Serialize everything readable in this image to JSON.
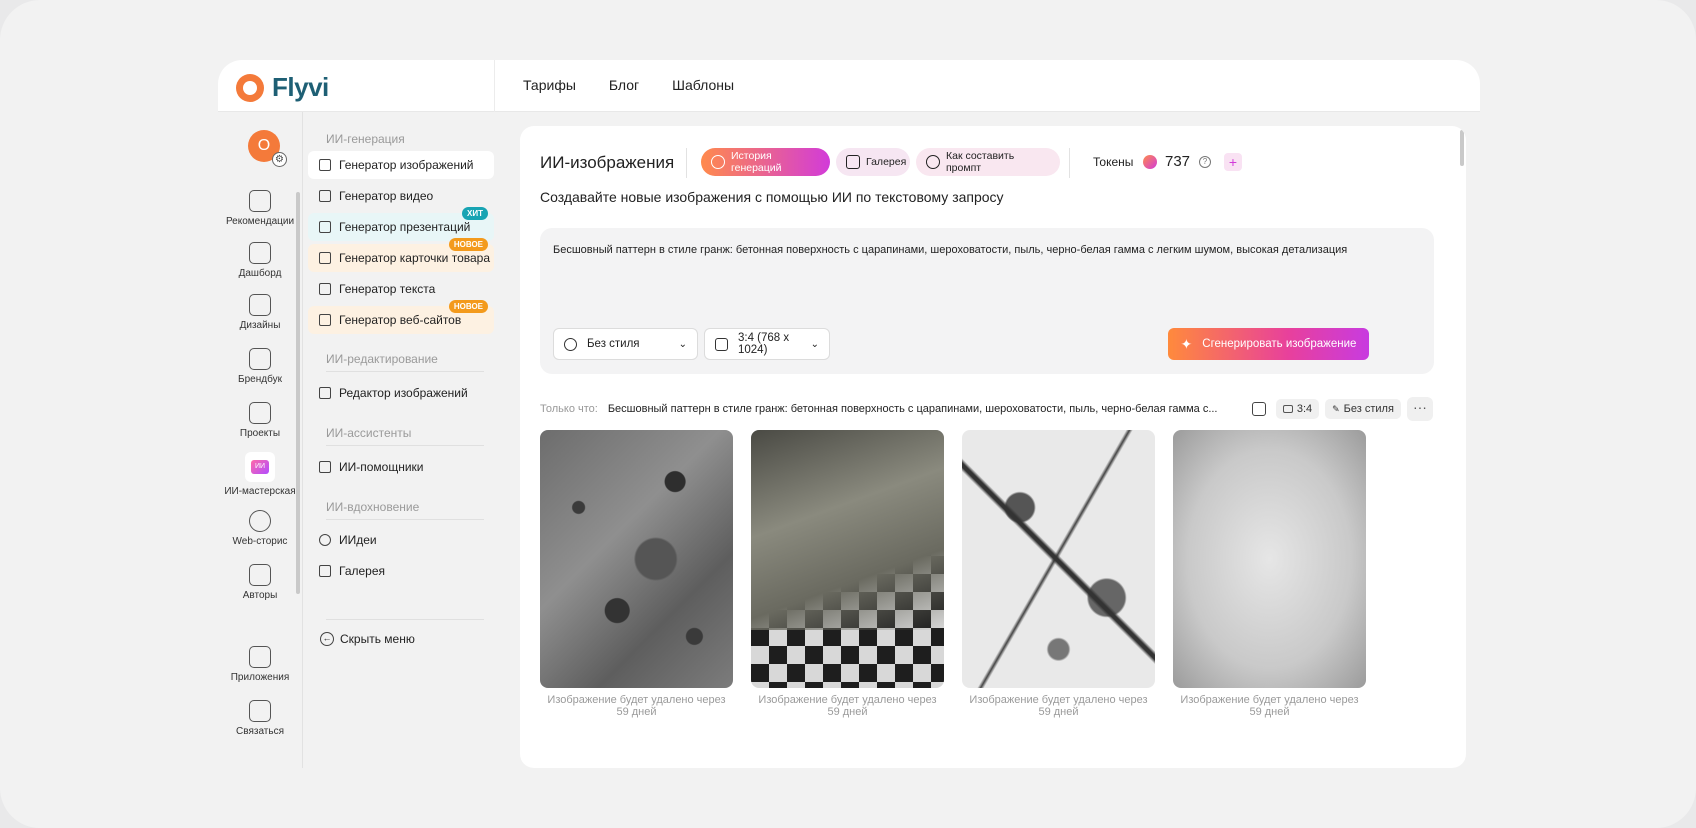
{
  "header": {
    "brand": "Flyvi",
    "nav": [
      "Тарифы",
      "Блог",
      "Шаблоны"
    ]
  },
  "rail": {
    "avatar_letter": "О",
    "items": [
      {
        "label": "Рекомендации",
        "icon": "recommendations-icon"
      },
      {
        "label": "Дашборд",
        "icon": "dashboard-icon"
      },
      {
        "label": "Дизайны",
        "icon": "designs-icon"
      },
      {
        "label": "Брендбук",
        "icon": "brandbook-icon"
      },
      {
        "label": "Проекты",
        "icon": "folder-icon"
      },
      {
        "label": "ИИ-мастерская",
        "icon": "ai-workshop-icon"
      },
      {
        "label": "Web-сторис",
        "icon": "web-stories-icon"
      },
      {
        "label": "Авторы",
        "icon": "authors-icon"
      },
      {
        "label": "Приложения",
        "icon": "apps-icon"
      },
      {
        "label": "Связаться",
        "icon": "chat-icon"
      }
    ],
    "ai_badge_text": "ИИ"
  },
  "menu": {
    "sections": {
      "generation": "ИИ-генерация",
      "editing": "ИИ-редактирование",
      "assistants": "ИИ-ассистенты",
      "inspiration": "ИИ-вдохновение"
    },
    "items": {
      "image_gen": "Генератор изображений",
      "video_gen": "Генератор видео",
      "presentation_gen": "Генератор презентаций",
      "card_gen": "Генератор карточки товара",
      "text_gen": "Генератор текста",
      "site_gen": "Генератор веб-сайтов",
      "image_editor": "Редактор изображений",
      "assistants": "ИИ-помощники",
      "ideas": "ИИдеи",
      "gallery": "Галерея"
    },
    "tags": {
      "hit": "ХИТ",
      "new": "НОВОЕ"
    },
    "hide_menu": "Скрыть меню"
  },
  "main": {
    "title": "ИИ-изображения",
    "pills": {
      "history": "История генераций",
      "gallery": "Галерея",
      "how_to": "Как составить промпт"
    },
    "tokens_label": "Токены",
    "tokens_value": "737",
    "subtitle": "Создавайте новые изображения с помощью ИИ по текстовому запросу",
    "prompt": "Бесшовный паттерн в стиле гранж: бетонная поверхность с царапинами, шероховатости, пыль, черно-белая гамма с легким шумом, высокая детализация",
    "style_select": "Без стиля",
    "ratio_select": "3:4 (768 x 1024)",
    "generate_button": "Сгенерировать изображение",
    "recent_label": "Только что:",
    "recent_prompt": "Бесшовный паттерн в стиле гранж: бетонная поверхность с царапинами, шероховатости, пыль, черно-белая гамма с...",
    "recent_ratio": "3:4",
    "recent_style": "Без стиля",
    "caption": "Изображение будет удалено через 59 дней"
  },
  "colors": {
    "brand_orange": "#f47a3a",
    "brand_text": "#1e5f74",
    "accent_gradient_start": "#ff8a3c",
    "accent_gradient_end": "#c83be0"
  }
}
